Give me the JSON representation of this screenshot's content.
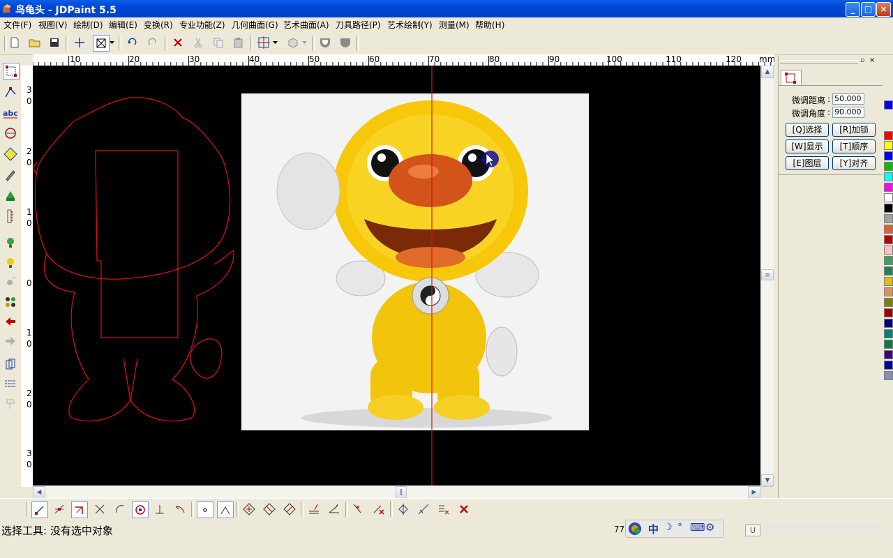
{
  "window": {
    "title": "鸟龟头 - JDPaint 5.5",
    "buttons": [
      "_",
      "□",
      "×"
    ]
  },
  "menu": [
    "文件(F)",
    "视图(V)",
    "绘制(D)",
    "编辑(E)",
    "变换(R)",
    "专业功能(Z)",
    "几何曲面(G)",
    "艺术曲面(A)",
    "刀具路径(P)",
    "艺术绘制(Y)",
    "测量(M)",
    "帮助(H)"
  ],
  "ruler": {
    "unit": "mm",
    "h_ticks": [
      "10",
      "20",
      "30",
      "40",
      "50",
      "60",
      "70",
      "80",
      "90",
      "100",
      "110",
      "120"
    ],
    "v_ticks": [
      "3",
      "0",
      "2",
      "0",
      "1",
      "0",
      "0",
      "1",
      "0",
      "2",
      "0",
      "3",
      "0"
    ]
  },
  "panel": {
    "fine_distance_label": "微调距离",
    "fine_distance_value": "50.000",
    "fine_angle_label": "微调角度",
    "fine_angle_value": "90.000",
    "buttons": [
      "[Q]选择",
      "[R]加锁",
      "[W]显示",
      "[T]顺序",
      "[E]图层",
      "[Y]对齐"
    ]
  },
  "palette": [
    "#0000ff",
    "#ff0000",
    "#ffff00",
    "#0000ff",
    "#00c000",
    "#00ffff",
    "#ff00ff",
    "#ffffff",
    "#000000",
    "#a0a0a0",
    "#e06030",
    "#c00000",
    "#ffc0c0",
    "#40a060",
    "#208060",
    "#e0c000",
    "#e09060",
    "#808000",
    "#a00000",
    "#000080",
    "#008080",
    "#008040",
    "#400080",
    "#0000a0",
    "#8090b0"
  ],
  "status": {
    "text": "选择工具: 没有选中对象",
    "coord_fragment": "77"
  },
  "ime": {
    "labels": [
      "中",
      "☽",
      "°",
      "⌨",
      "⚙"
    ]
  }
}
